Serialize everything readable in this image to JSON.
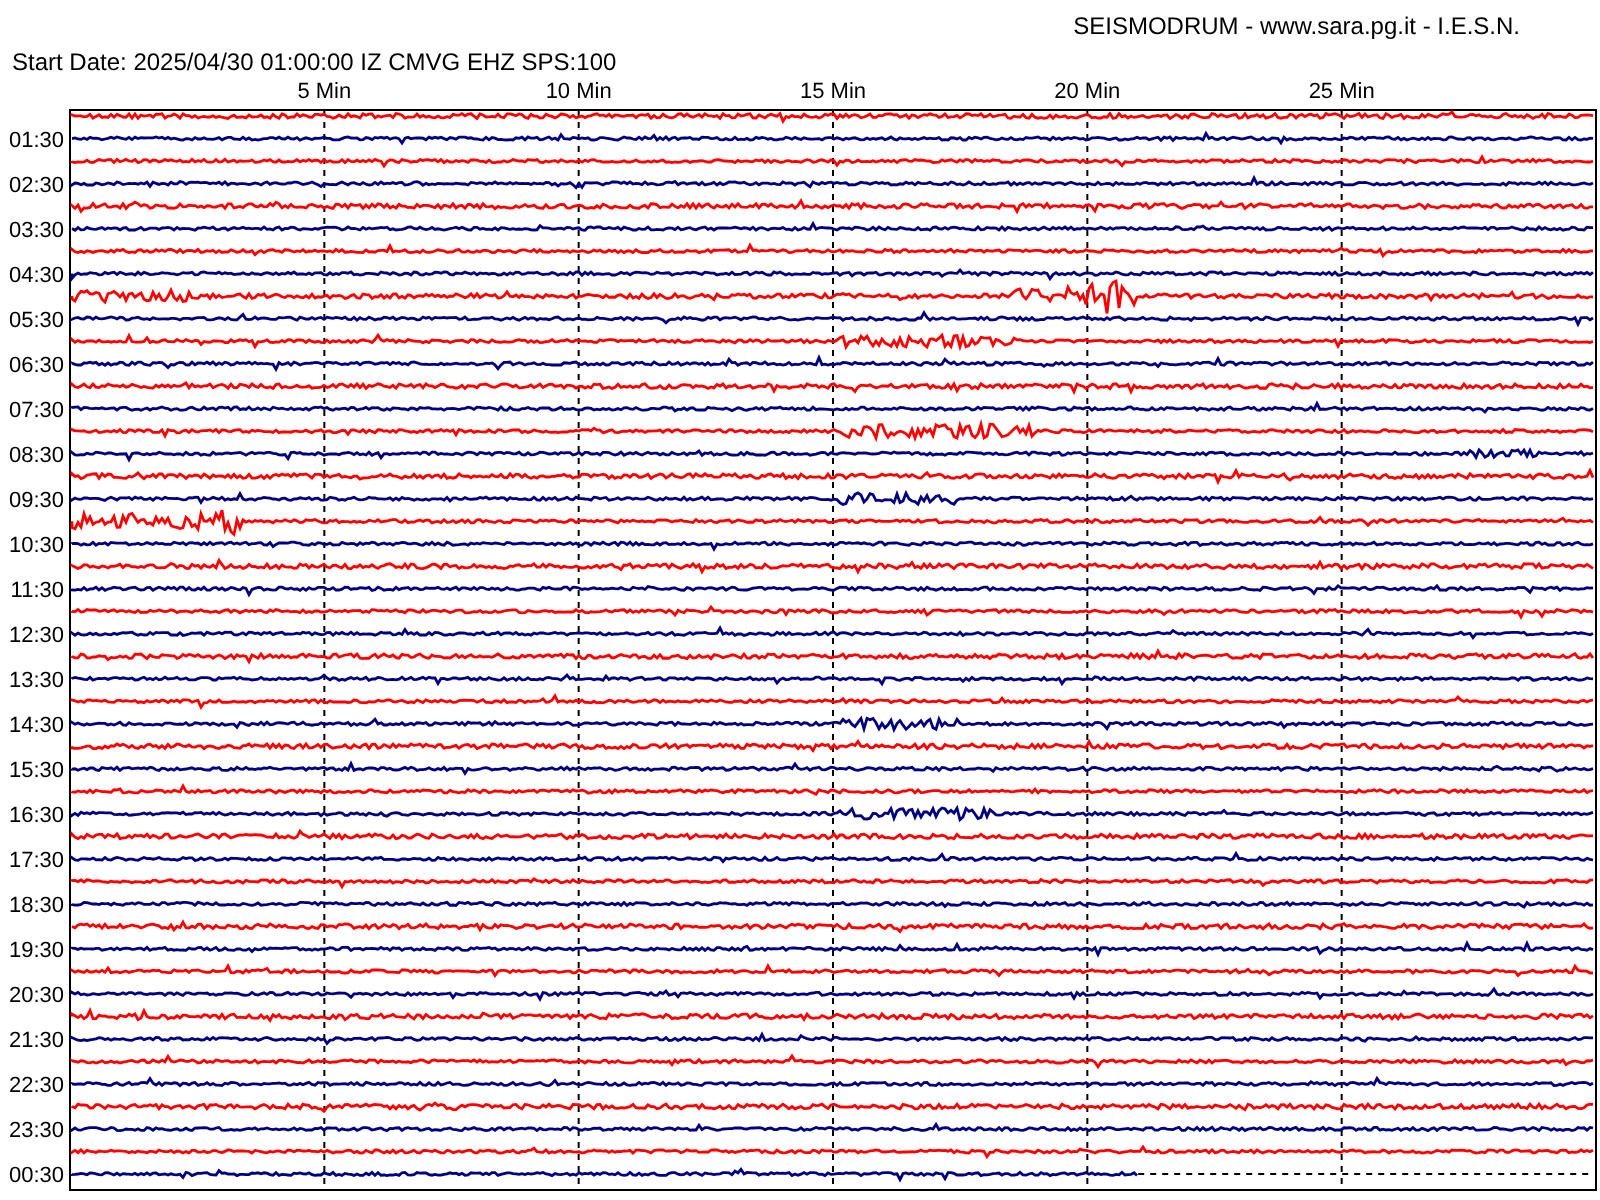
{
  "header": {
    "title": "SEISMODRUM - www.sara.pg.it - I.E.S.N.",
    "start_info": "Start Date: 2025/04/30 01:00:00 IZ CMVG EHZ SPS:100"
  },
  "minute_labels": [
    "5 Min",
    "10 Min",
    "15 Min",
    "20 Min",
    "25 Min"
  ],
  "traces": [
    {
      "color": "#ff0000",
      "in_progress": false
    },
    {
      "label": "01:30",
      "color": "#000080",
      "in_progress": false
    },
    {
      "color": "#ff0000",
      "in_progress": false
    },
    {
      "label": "02:30",
      "color": "#000080",
      "in_progress": false
    },
    {
      "color": "#ff0000",
      "in_progress": false
    },
    {
      "label": "03:30",
      "color": "#000080",
      "in_progress": false
    },
    {
      "color": "#ff0000",
      "in_progress": false
    },
    {
      "label": "04:30",
      "color": "#000080",
      "in_progress": false
    },
    {
      "color": "#ff0000",
      "in_progress": false
    },
    {
      "label": "05:30",
      "color": "#000080",
      "in_progress": false
    },
    {
      "color": "#ff0000",
      "in_progress": false
    },
    {
      "label": "06:30",
      "color": "#000080",
      "in_progress": false
    },
    {
      "color": "#ff0000",
      "in_progress": false
    },
    {
      "label": "07:30",
      "color": "#000080",
      "in_progress": false
    },
    {
      "color": "#ff0000",
      "in_progress": false
    },
    {
      "label": "08:30",
      "color": "#000080",
      "in_progress": false
    },
    {
      "color": "#ff0000",
      "in_progress": false
    },
    {
      "label": "09:30",
      "color": "#000080",
      "in_progress": false
    },
    {
      "color": "#ff0000",
      "in_progress": false
    },
    {
      "label": "10:30",
      "color": "#000080",
      "in_progress": false
    },
    {
      "color": "#ff0000",
      "in_progress": false
    },
    {
      "label": "11:30",
      "color": "#000080",
      "in_progress": false
    },
    {
      "color": "#ff0000",
      "in_progress": false
    },
    {
      "label": "12:30",
      "color": "#000080",
      "in_progress": false
    },
    {
      "color": "#ff0000",
      "in_progress": false
    },
    {
      "label": "13:30",
      "color": "#000080",
      "in_progress": false
    },
    {
      "color": "#ff0000",
      "in_progress": false
    },
    {
      "label": "14:30",
      "color": "#000080",
      "in_progress": false
    },
    {
      "color": "#ff0000",
      "in_progress": false
    },
    {
      "label": "15:30",
      "color": "#000080",
      "in_progress": false
    },
    {
      "color": "#ff0000",
      "in_progress": false
    },
    {
      "label": "16:30",
      "color": "#000080",
      "in_progress": false
    },
    {
      "color": "#ff0000",
      "in_progress": false
    },
    {
      "label": "17:30",
      "color": "#000080",
      "in_progress": false
    },
    {
      "color": "#ff0000",
      "in_progress": false
    },
    {
      "label": "18:30",
      "color": "#000080",
      "in_progress": false
    },
    {
      "color": "#ff0000",
      "in_progress": false
    },
    {
      "label": "19:30",
      "color": "#000080",
      "in_progress": false
    },
    {
      "color": "#ff0000",
      "in_progress": false
    },
    {
      "label": "20:30",
      "color": "#000080",
      "in_progress": false
    },
    {
      "color": "#ff0000",
      "in_progress": false
    },
    {
      "label": "21:30",
      "color": "#000080",
      "in_progress": false
    },
    {
      "color": "#ff0000",
      "in_progress": false
    },
    {
      "label": "22:30",
      "color": "#000080",
      "in_progress": false
    },
    {
      "color": "#ff0000",
      "in_progress": false
    },
    {
      "label": "23:30",
      "color": "#000080",
      "in_progress": false
    },
    {
      "color": "#ff0000",
      "in_progress": false
    },
    {
      "label": "00:30",
      "color": "#000080",
      "in_progress": true
    }
  ]
}
